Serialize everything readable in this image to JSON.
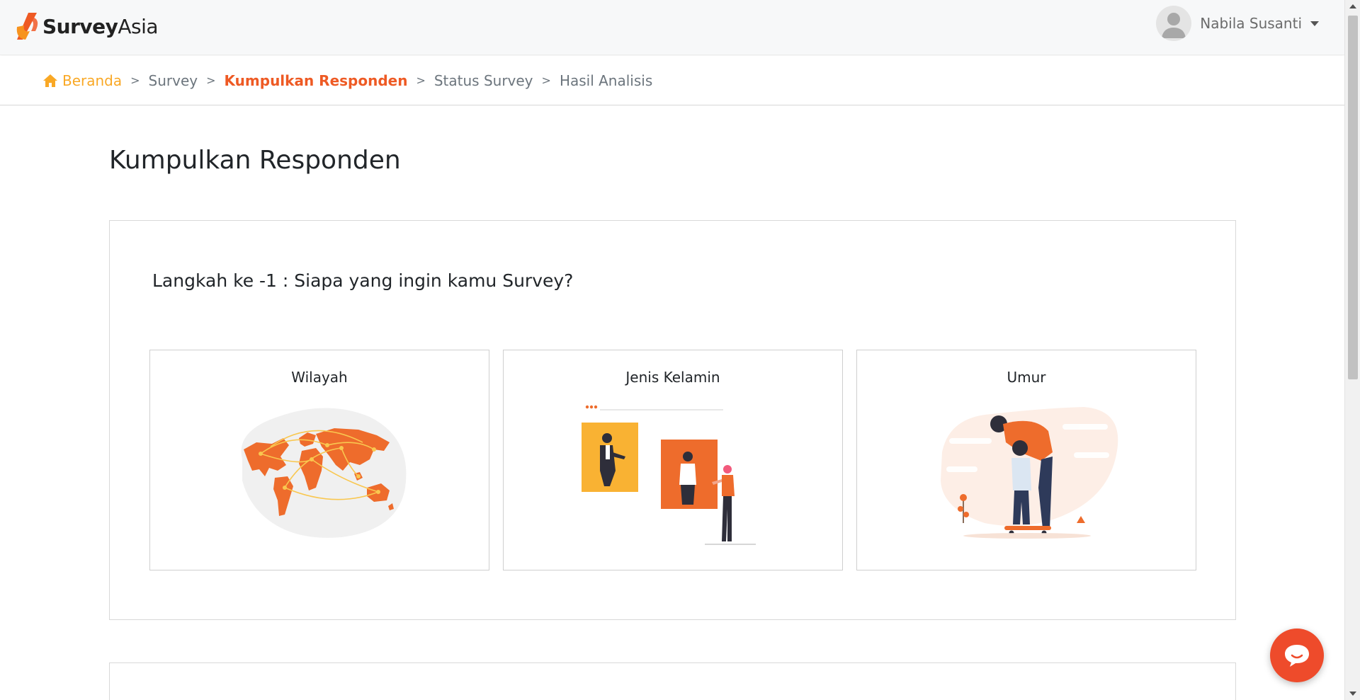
{
  "brand": {
    "name_bold": "Survey",
    "name_light": "Asia",
    "accent": "#ee5a24",
    "home_color": "#f9a825"
  },
  "user": {
    "name": "Nabila Susanti"
  },
  "breadcrumb": [
    {
      "label": "Beranda",
      "icon": "home-icon"
    },
    {
      "label": "Survey"
    },
    {
      "label": "Kumpulkan Responden",
      "active": true
    },
    {
      "label": "Status Survey"
    },
    {
      "label": "Hasil Analisis"
    }
  ],
  "page": {
    "title": "Kumpulkan Responden"
  },
  "step": {
    "title": "Langkah ke -1 : Siapa yang ingin kamu Survey?",
    "options": [
      {
        "label": "Wilayah",
        "illustration": "world-map-illustration"
      },
      {
        "label": "Jenis Kelamin",
        "illustration": "gender-illustration"
      },
      {
        "label": "Umur",
        "illustration": "age-illustration"
      }
    ]
  },
  "chat": {
    "icon": "chat-bubble-icon"
  }
}
